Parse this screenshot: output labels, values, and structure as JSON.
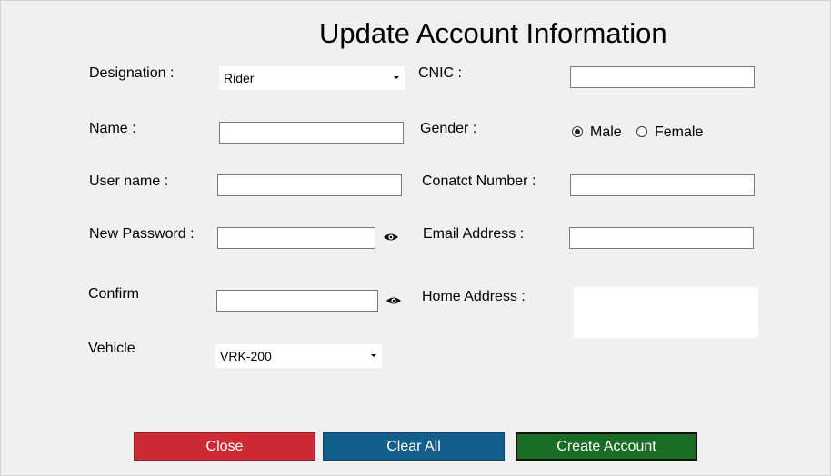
{
  "title": "Update Account Information",
  "fields": {
    "designation": {
      "label": "Designation :",
      "value": "Rider"
    },
    "cnic": {
      "label": "CNIC :",
      "value": ""
    },
    "name": {
      "label": "Name :",
      "value": ""
    },
    "gender": {
      "label": "Gender :",
      "options": [
        "Male",
        "Female"
      ],
      "selected": "Male"
    },
    "username": {
      "label": "User name :",
      "value": ""
    },
    "contact": {
      "label": "Conatct Number :",
      "value": ""
    },
    "new_password": {
      "label": "New Password :",
      "value": ""
    },
    "email": {
      "label": "Email Address :",
      "value": ""
    },
    "confirm": {
      "label": "Confirm",
      "value": ""
    },
    "home_address": {
      "label": "Home Address :",
      "value": ""
    },
    "vehicle": {
      "label": "Vehicle",
      "value": "VRK-200"
    }
  },
  "icons": {
    "password_toggle": "eye-icon",
    "confirm_toggle": "eye-icon"
  },
  "buttons": {
    "close": "Close",
    "clear": "Clear All",
    "create": "Create Account"
  },
  "colors": {
    "close": "#cd2a36",
    "clear": "#135f8c",
    "create": "#1a6b23"
  }
}
